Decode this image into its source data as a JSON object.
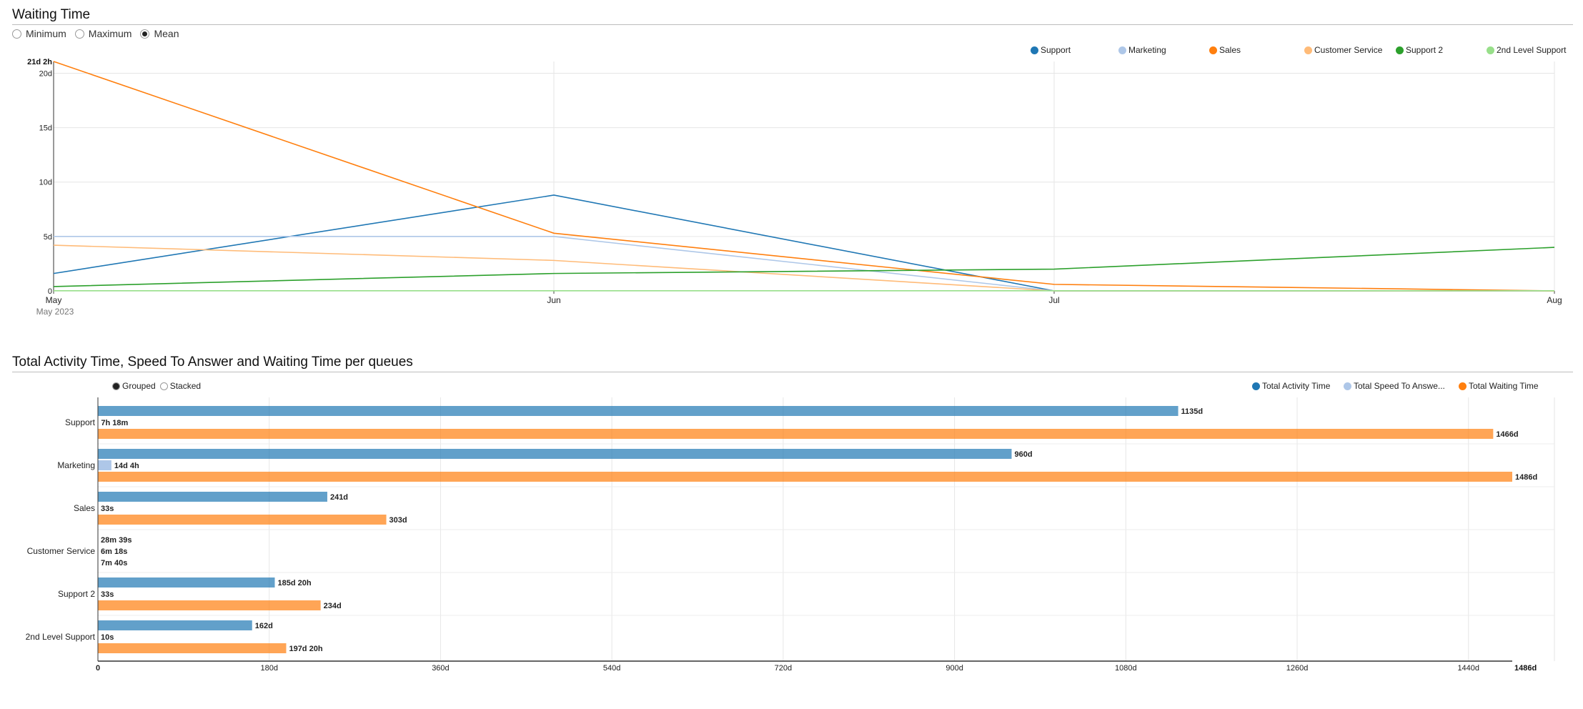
{
  "line_section": {
    "title": "Waiting Time",
    "radios": [
      {
        "label": "Minimum",
        "selected": false
      },
      {
        "label": "Maximum",
        "selected": false
      },
      {
        "label": "Mean",
        "selected": true
      }
    ]
  },
  "bar_section": {
    "title": "Total Activity Time, Speed To Answer and Waiting Time per queues",
    "radios": [
      {
        "label": "Grouped",
        "selected": true
      },
      {
        "label": "Stacked",
        "selected": false
      }
    ]
  },
  "chart_data": [
    {
      "type": "line",
      "x": [
        "May",
        "Jun",
        "Jul",
        "Aug"
      ],
      "x_sublabel": "May 2023",
      "y_ticks": [
        "0",
        "5d",
        "10d",
        "15d",
        "20d"
      ],
      "y_max_label": "21d 2h",
      "ylim_days": [
        0,
        21.08
      ],
      "series": [
        {
          "name": "Support",
          "color": "#1f77b4",
          "values": [
            1.6,
            8.8,
            0,
            0
          ]
        },
        {
          "name": "Marketing",
          "color": "#aec7e8",
          "values": [
            5.0,
            5.0,
            0,
            0
          ]
        },
        {
          "name": "Sales",
          "color": "#ff7f0e",
          "values": [
            21.08,
            5.3,
            0.6,
            0
          ]
        },
        {
          "name": "Customer Service",
          "color": "#ffbb78",
          "values": [
            4.2,
            2.8,
            0,
            0
          ]
        },
        {
          "name": "Support 2",
          "color": "#2ca02c",
          "values": [
            0.4,
            1.6,
            2.0,
            4.0
          ]
        },
        {
          "name": "2nd Level Support",
          "color": "#98df8a",
          "values": [
            0.01,
            0.01,
            0.01,
            0.01
          ]
        }
      ]
    },
    {
      "type": "bar",
      "orientation": "horizontal",
      "categories": [
        "Support",
        "Marketing",
        "Sales",
        "Customer Service",
        "Support 2",
        "2nd Level Support"
      ],
      "x_ticks": [
        "0",
        "180d",
        "360d",
        "540d",
        "720d",
        "900d",
        "1080d",
        "1260d",
        "1440d"
      ],
      "x_max_label": "1486d",
      "xlim_days": [
        0,
        1486
      ],
      "series": [
        {
          "name": "Total Activity Time",
          "color": "#1f77b4",
          "values": [
            1135,
            960,
            241,
            0.0199,
            185.83,
            162
          ],
          "labels": [
            "1135d",
            "960d",
            "241d",
            "28m 39s",
            "185d 20h",
            "162d"
          ]
        },
        {
          "name": "Total Speed To Answe...",
          "color": "#aec7e8",
          "values": [
            0.304,
            14.17,
            0.0004,
            0.0044,
            0.0004,
            0.0001
          ],
          "labels": [
            "7h 18m",
            "14d 4h",
            "33s",
            "6m 18s",
            "33s",
            "10s"
          ]
        },
        {
          "name": "Total Waiting Time",
          "color": "#ff7f0e",
          "values": [
            1466,
            1486,
            303,
            0.0053,
            234,
            197.83
          ],
          "labels": [
            "1466d",
            "1486d",
            "303d",
            "7m 40s",
            "234d",
            "197d 20h"
          ]
        }
      ]
    }
  ]
}
